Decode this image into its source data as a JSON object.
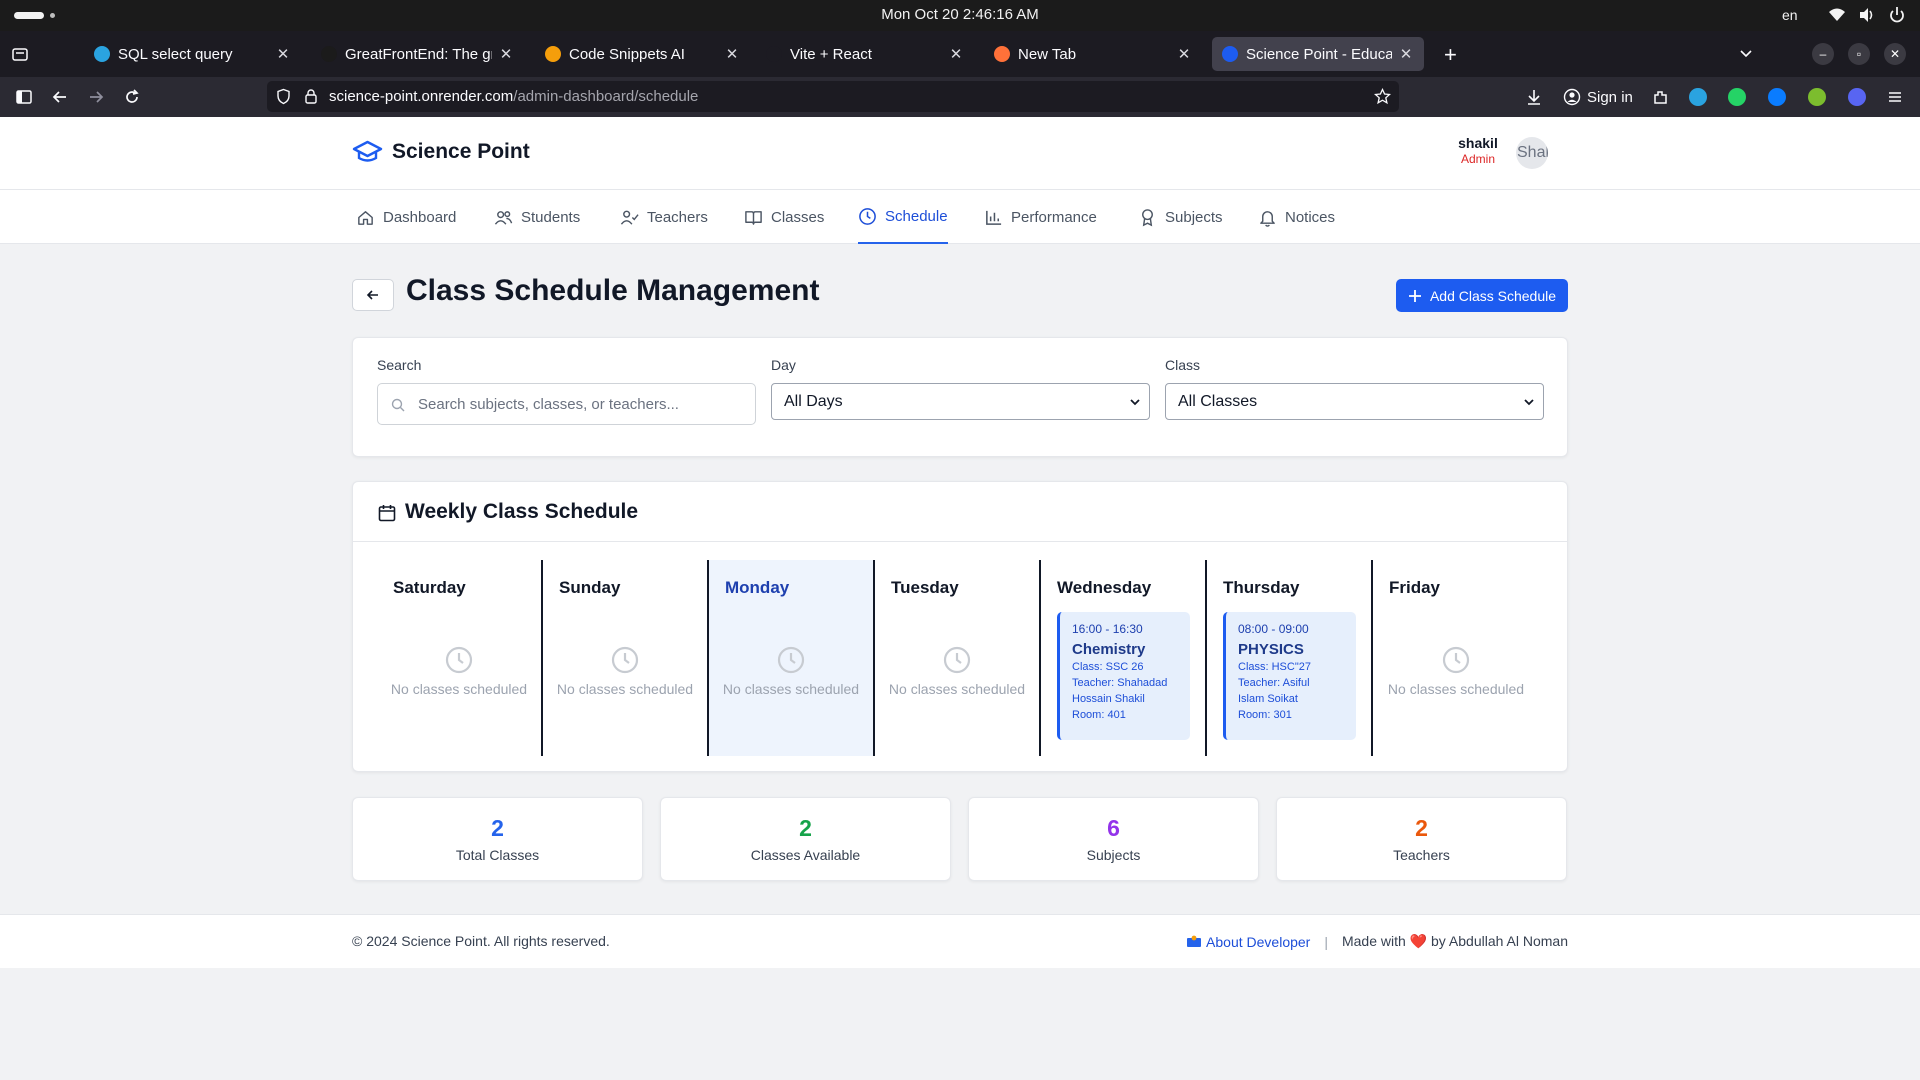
{
  "os": {
    "clock": "Mon Oct 20    2:46:16 AM",
    "lang": "en"
  },
  "browser": {
    "tabs": [
      {
        "title": "SQL select query",
        "icon": "telegram-icon",
        "color": "#2aa3e0"
      },
      {
        "title": "GreatFrontEnd: The great",
        "icon": "greatfrontend-icon",
        "color": "#1b1b1b"
      },
      {
        "title": "Code Snippets AI",
        "icon": "code-snippets-icon",
        "color": "#f59e0b"
      },
      {
        "title": "Vite + React",
        "icon": "blank-icon",
        "color": "#1c1b22"
      },
      {
        "title": "New Tab",
        "icon": "firefox-icon",
        "color": "#ff7139"
      },
      {
        "title": "Science Point - Education",
        "icon": "science-point-icon",
        "color": "#1d5cf0"
      }
    ],
    "url_host": "science-point.onrender.com",
    "url_path": "/admin-dashboard/schedule",
    "sign_in": "Sign in"
  },
  "app": {
    "brand": "Science Point",
    "user": {
      "name": "shakil",
      "role": "Admin",
      "avatar_text": "Shakil"
    },
    "nav": [
      {
        "label": "Dashboard",
        "icon": "home-icon"
      },
      {
        "label": "Students",
        "icon": "users-icon"
      },
      {
        "label": "Teachers",
        "icon": "teacher-icon"
      },
      {
        "label": "Classes",
        "icon": "book-icon"
      },
      {
        "label": "Schedule",
        "icon": "clock-icon",
        "active": true
      },
      {
        "label": "Performance",
        "icon": "bar-chart-icon"
      },
      {
        "label": "Subjects",
        "icon": "award-icon"
      },
      {
        "label": "Notices",
        "icon": "bell-icon"
      }
    ]
  },
  "page": {
    "title": "Class Schedule Management",
    "add_button": "Add Class Schedule"
  },
  "filters": {
    "search_label": "Search",
    "search_placeholder": "Search subjects, classes, or teachers...",
    "day_label": "Day",
    "day_value": "All Days",
    "class_label": "Class",
    "class_value": "All Classes"
  },
  "schedule": {
    "title": "Weekly Class Schedule",
    "empty_text": "No classes scheduled",
    "days": [
      {
        "name": "Saturday"
      },
      {
        "name": "Sunday"
      },
      {
        "name": "Monday",
        "today": true
      },
      {
        "name": "Tuesday"
      },
      {
        "name": "Wednesday",
        "class": {
          "time": "16:00 - 16:30",
          "subject": "Chemistry",
          "lines": [
            "Class: SSC 26",
            "Teacher: Shahadad",
            "Hossain Shakil",
            "Room: 401"
          ]
        }
      },
      {
        "name": "Thursday",
        "class": {
          "time": "08:00 - 09:00",
          "subject": "PHYSICS",
          "lines": [
            "Class: HSC\"27",
            "Teacher: Asiful",
            "Islam Soikat",
            "Room: 301"
          ]
        }
      },
      {
        "name": "Friday"
      }
    ]
  },
  "stats": [
    {
      "value": "2",
      "label": "Total Classes",
      "color": "#2563eb"
    },
    {
      "value": "2",
      "label": "Classes Available",
      "color": "#16a34a"
    },
    {
      "value": "6",
      "label": "Subjects",
      "color": "#9333ea"
    },
    {
      "value": "2",
      "label": "Teachers",
      "color": "#ea580c"
    }
  ],
  "footer": {
    "copyright": "© 2024 Science Point. All rights reserved.",
    "about": "About Developer",
    "made_with": "Made with",
    "made_by": "by Abdullah Al Noman"
  }
}
